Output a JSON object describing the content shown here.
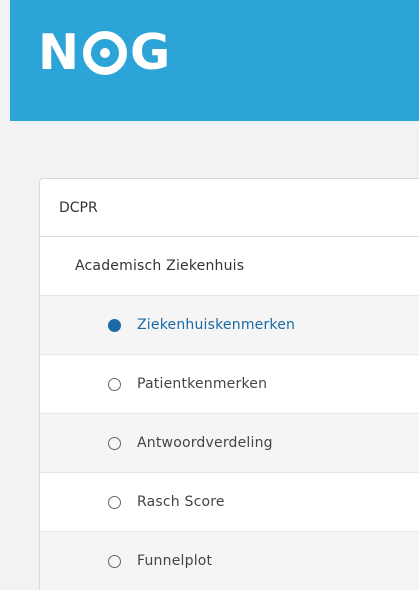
{
  "header": {
    "logo_text": "NOG"
  },
  "panel": {
    "title": "DCPR",
    "organization": "Academisch Ziekenhuis",
    "items": [
      {
        "label": "Ziekenhuiskenmerken",
        "selected": true
      },
      {
        "label": "Patientkenmerken",
        "selected": false
      },
      {
        "label": "Antwoordverdeling",
        "selected": false
      },
      {
        "label": "Rasch Score",
        "selected": false
      },
      {
        "label": "Funnelplot",
        "selected": false
      }
    ]
  },
  "colors": {
    "header_bg": "#2da4d8",
    "accent": "#1a6aa6"
  }
}
